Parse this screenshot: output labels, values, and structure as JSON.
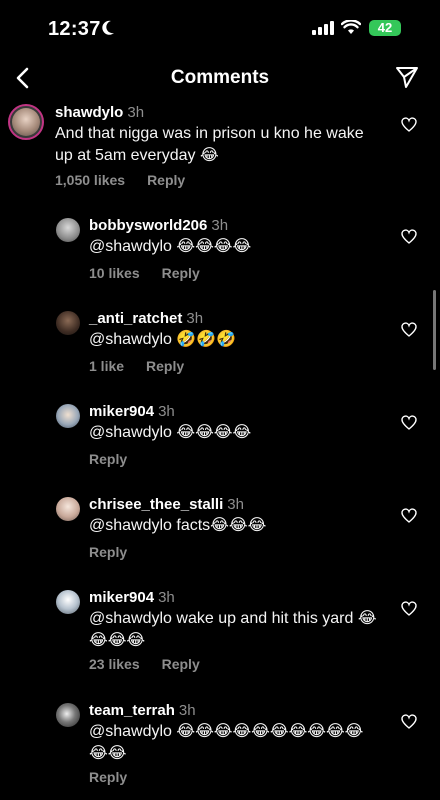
{
  "status_bar": {
    "time": "12:37",
    "battery": "42"
  },
  "header": {
    "title": "Comments"
  },
  "main_comment": {
    "username": "shawdylo",
    "time": "3h",
    "text": "And that nigga was in prison u kno he wake up at 5am everyday 😂",
    "likes": "1,050 likes",
    "reply": "Reply"
  },
  "replies": [
    {
      "username": "bobbysworld206",
      "time": "3h",
      "text": "@shawdylo 😂😂😂😂",
      "likes": "10 likes",
      "reply": "Reply"
    },
    {
      "username": "_anti_ratchet",
      "time": "3h",
      "text": "@shawdylo 🤣🤣🤣",
      "likes": "1 like",
      "reply": "Reply"
    },
    {
      "username": "miker904",
      "time": "3h",
      "text": "@shawdylo 😂😂😂😂",
      "likes": "",
      "reply": "Reply"
    },
    {
      "username": "chrisee_thee_stalli",
      "time": "3h",
      "text": "@shawdylo facts😂😂😂",
      "likes": "",
      "reply": "Reply"
    },
    {
      "username": "miker904",
      "time": "3h",
      "text": "@shawdylo wake up and hit this yard 😂😂😂😂",
      "likes": "23 likes",
      "reply": "Reply"
    },
    {
      "username": "team_terrah",
      "time": "3h",
      "text": "@shawdylo 😂😂😂😂😂😂😂😂😂😂😂😂",
      "likes": "",
      "reply": "Reply"
    }
  ]
}
